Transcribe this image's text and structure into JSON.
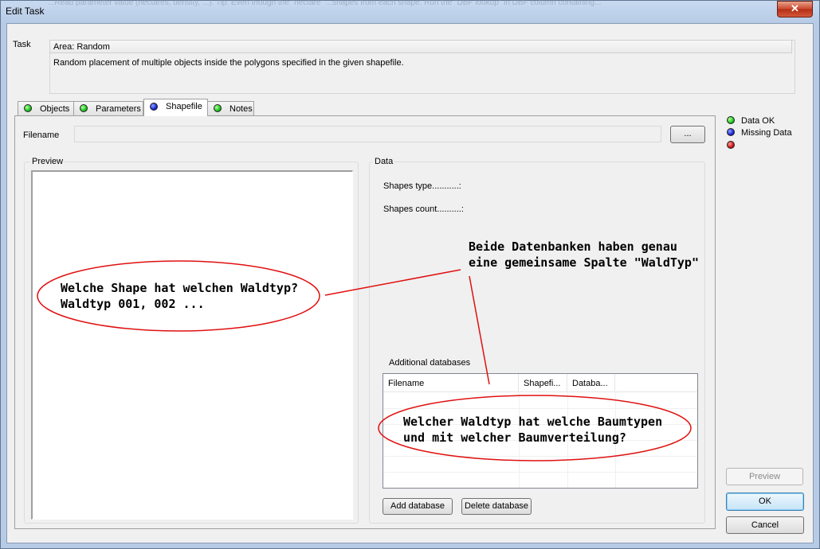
{
  "window": {
    "title": "Edit Task",
    "close_glyph": "✕",
    "background_text": "...Read parameter value (hectares, density, ...). Tip: Even though the \"hectare\" ...shapes from each shape. Run the \"DBF lookup\" in DBF column containing..."
  },
  "task": {
    "label": "Task",
    "title": "Area: Random",
    "description": "Random placement of multiple objects inside the polygons specified in the given shapefile."
  },
  "tabs": [
    {
      "label": "Objects",
      "status": "green"
    },
    {
      "label": "Parameters",
      "status": "green"
    },
    {
      "label": "Shapefile",
      "status": "blue",
      "active": true
    },
    {
      "label": "Notes",
      "status": "green"
    }
  ],
  "shapefile": {
    "filename_label": "Filename",
    "filename_value": "",
    "browse_label": "...",
    "preview_caption": "Preview",
    "data_caption": "Data",
    "shapes_type": "Shapes type...........:",
    "shapes_count": "Shapes count..........:",
    "additional_caption": "Additional databases",
    "table_columns": [
      "Filename",
      "Shapefi...",
      "Databa..."
    ],
    "add_database": "Add database",
    "delete_database": "Delete database"
  },
  "legend": {
    "ok": "Data OK",
    "missing": "Missing Data",
    "third": "",
    "colors": {
      "ok": "#18c51a",
      "missing": "#1b23d8",
      "error": "#d01515"
    }
  },
  "buttons": {
    "preview": "Preview",
    "ok": "OK",
    "cancel": "Cancel"
  },
  "annotations": {
    "right_top_line1": "Beide Datenbanken haben genau",
    "right_top_line2": "eine gemeinsame Spalte \"WaldTyp\"",
    "left_line1": "Welche Shape hat welchen Waldtyp?",
    "left_line2": "Waldtyp 001, 002 ...",
    "bottom_line1": "Welcher Waldtyp hat welche Baumtypen",
    "bottom_line2": "und mit welcher Baumverteilung?",
    "color": "#e01010"
  }
}
